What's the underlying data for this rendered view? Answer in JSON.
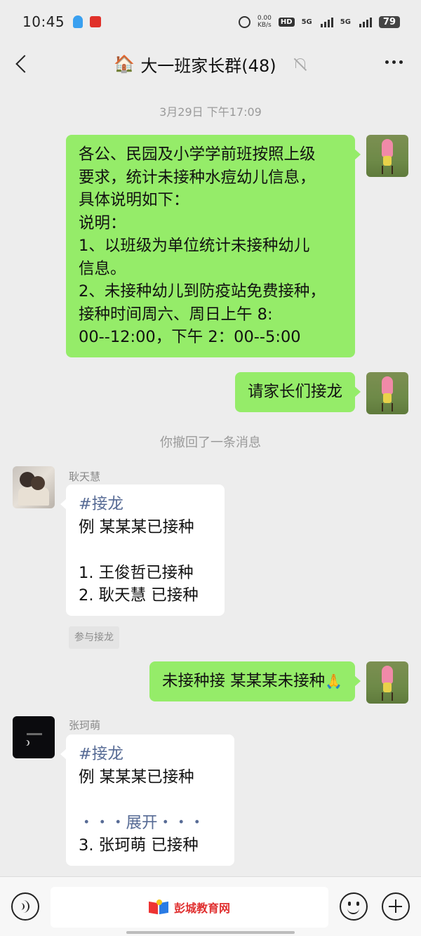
{
  "status_bar": {
    "time": "10:45",
    "net_speed_value": "0.00",
    "net_speed_unit": "KB/s",
    "hd_label": "HD",
    "sim1_label": "5G",
    "sim2_label": "5G",
    "battery": "79"
  },
  "header": {
    "title": "大一班家长群(48)",
    "icon_emoji": "🏠"
  },
  "chat": {
    "timestamp": "3月29日 下午17:09",
    "messages": [
      {
        "lines": [
          "各公、民园及小学学前班按照上级",
          "要求，统计未接种水痘幼儿信息，",
          "具体说明如下：",
          "说明：",
          "1、以班级为单位统计未接种幼儿",
          "信息。",
          "2、未接种幼儿到防疫站免费接种，",
          "接种时间周六、周日上午 8:",
          "00--12:00，下午 2：00--5:00"
        ]
      },
      {
        "text": "请家长们接龙"
      },
      {
        "system": "你撤回了一条消息"
      },
      {
        "sender": "耿天慧",
        "lines": [
          "#接龙",
          "例 某某某已接种",
          "",
          "1. 王俊哲已接种",
          "2. 耿天慧 已接种"
        ],
        "button": "参与接龙"
      },
      {
        "text": "未接种接  某某某未接种",
        "emoji": "🙏"
      },
      {
        "sender": "张珂萌",
        "lines": [
          "#接龙",
          "例 某某某已接种",
          "",
          "・・・展开・・・",
          "3. 张珂萌 已接种"
        ]
      }
    ]
  },
  "input_bar": {
    "watermark": "彭城教育网"
  },
  "colors": {
    "background": "#ededed",
    "outgoing_bubble": "#95ec69",
    "incoming_bubble": "#ffffff",
    "link_blue": "#576b95"
  }
}
